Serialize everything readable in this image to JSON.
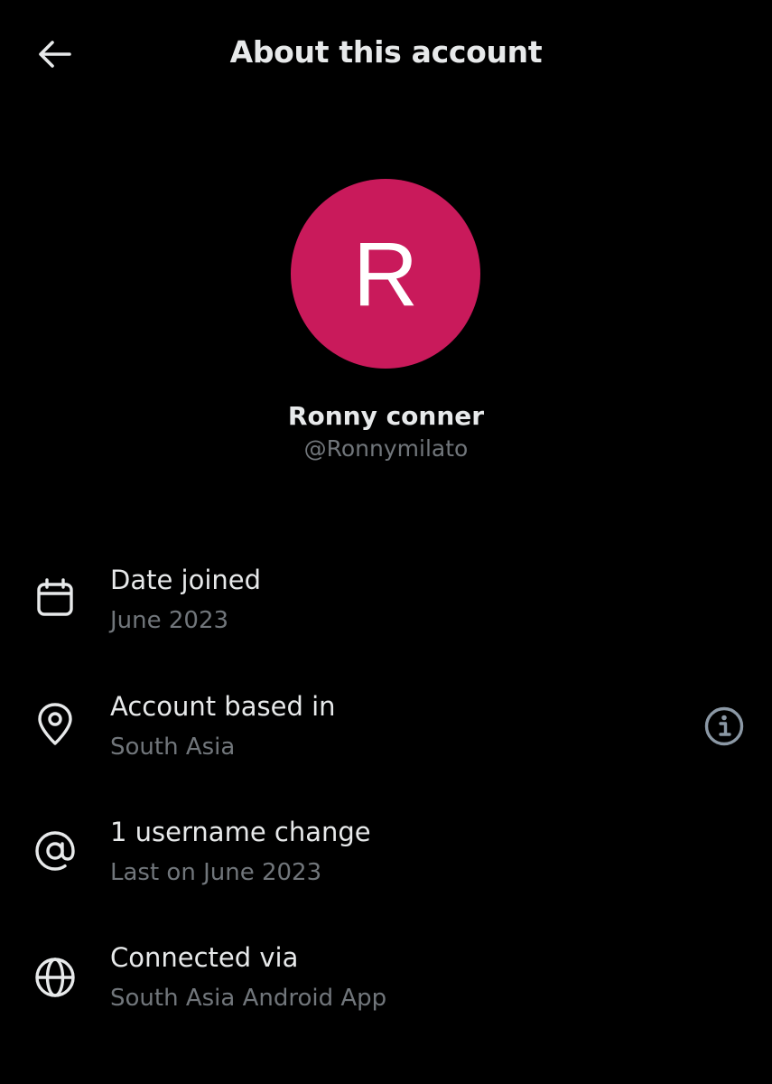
{
  "header": {
    "title": "About this account",
    "back_icon": "arrow-left-icon"
  },
  "profile": {
    "avatar_letter": "R",
    "avatar_color": "#c91a5b",
    "name": "Ronny conner",
    "handle": "@Ronnymilato"
  },
  "details": [
    {
      "icon": "calendar-icon",
      "title": "Date joined",
      "subtitle": "June 2023"
    },
    {
      "icon": "location-pin-icon",
      "title": "Account based in",
      "subtitle": "South Asia",
      "action_icon": "info-icon"
    },
    {
      "icon": "at-sign-icon",
      "title": "1 username change",
      "subtitle": "Last on June 2023"
    },
    {
      "icon": "globe-icon",
      "title": "Connected via",
      "subtitle": "South Asia Android App"
    }
  ],
  "colors": {
    "background": "#000000",
    "primary_text": "#e7e9ea",
    "secondary_text": "#71767b"
  }
}
